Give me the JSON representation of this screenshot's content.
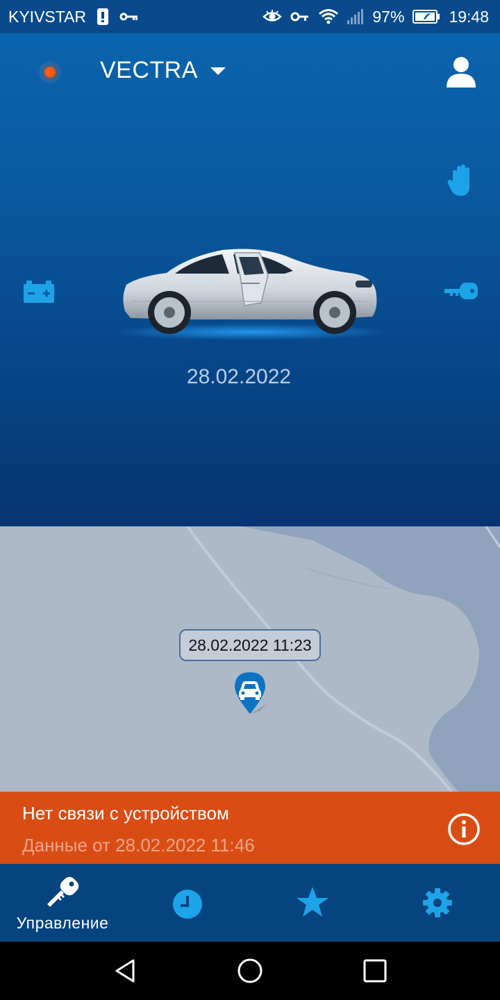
{
  "status_bar": {
    "carrier": "KYIVSTAR",
    "battery_percent": "97%",
    "time": "19:48",
    "icons": [
      "sim-icon",
      "vpn-key-icon",
      "eye-icon",
      "key-icon",
      "wifi-icon",
      "signal-icon",
      "battery-icon"
    ]
  },
  "header": {
    "vehicle_name": "VECTRA",
    "status_color": "#ff5a10"
  },
  "car_panel": {
    "date": "28.02.2022",
    "door_state": "open",
    "icons": [
      "battery-icon",
      "hand-icon",
      "key-icon",
      "profile-icon"
    ]
  },
  "map": {
    "marker_time": "28.02.2022 11:23",
    "marker_icon": "car-pin-icon"
  },
  "alert": {
    "title": "Нет связи с устройством",
    "subtitle": "Данные от 28.02.2022 11:46",
    "color": "#d94d15"
  },
  "bottom_nav": {
    "items": [
      {
        "label": "Управление",
        "icon": "key-icon",
        "active": true
      },
      {
        "label": "",
        "icon": "clock-icon",
        "active": false
      },
      {
        "label": "",
        "icon": "star-icon",
        "active": false
      },
      {
        "label": "",
        "icon": "gear-icon",
        "active": false
      }
    ]
  },
  "colors": {
    "accent": "#1ea3e8",
    "nav_background": "#06447f"
  }
}
